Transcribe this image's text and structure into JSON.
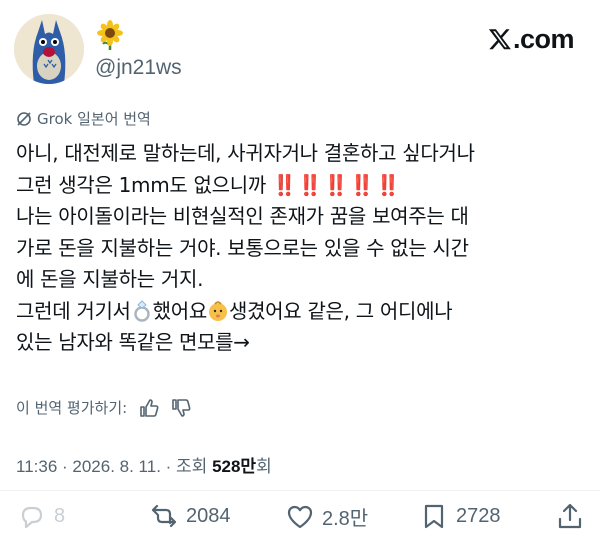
{
  "profile": {
    "handle": "@jn21ws",
    "name_emoji": "sunflower-icon",
    "avatar": "totoro-avatar"
  },
  "brand": {
    "logo_text": ".com"
  },
  "translation": {
    "label": "Grok 일본어 번역"
  },
  "tweet": {
    "lines": [
      "아니, 대전제로 말하는데, 사귀자거나 결혼하고 싶다거나",
      "그런 생각은 1mm도 없으니까",
      "나는 아이돌이라는 비현실적인 존재가 꿈을 보여주는 대",
      "가로 돈을 지불하는 거야. 보통으로는 있을 수 없는 시간",
      "에 돈을 지불하는 거지.",
      "그런데 거기서",
      "있는 남자와 똑같은 면모를→"
    ],
    "exclaim": "‼️‼️‼️‼️‼️",
    "line6_part2": "했어요",
    "line6_part3": "생겼어요 같은, 그 어디에나"
  },
  "rating": {
    "label": "이 번역 평가하기:"
  },
  "meta": {
    "time": "11:36",
    "sep1": " · ",
    "date": "2026. 8. 11.",
    "sep2": " · ",
    "views_label": "조회 ",
    "views_count": "528만",
    "views_suffix": "회"
  },
  "actions": {
    "replies": "8",
    "reposts": "2084",
    "likes": "2.8만",
    "bookmarks": "2728"
  },
  "colors": {
    "text": "#0f1419",
    "muted": "#536471",
    "exclaim": "#e0245e"
  }
}
